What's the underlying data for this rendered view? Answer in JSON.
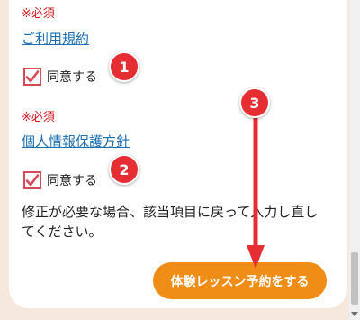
{
  "terms": {
    "required_label": "※必須",
    "link_label": "ご利用規約",
    "agree_label": "同意する",
    "checked": true
  },
  "privacy": {
    "required_label": "※必須",
    "link_label": "個人情報保護方針",
    "agree_label": "同意する",
    "checked": true
  },
  "note_text": "修正が必要な場合、該当項目に戻って入力し直してください。",
  "submit_label": "体験レッスン予約をする",
  "annotations": {
    "badge1": "1",
    "badge2": "2",
    "badge3": "3"
  },
  "colors": {
    "background": "#f6e8dc",
    "required": "#d0191f",
    "link": "#1d6fb1",
    "checkbox": "#d74a57",
    "button": "#ef8d16",
    "annotation": "#e52d34"
  }
}
